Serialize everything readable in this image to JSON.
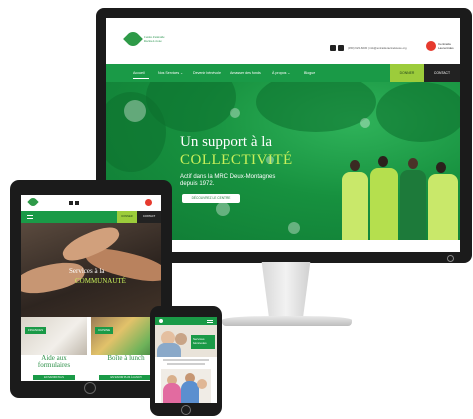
{
  "desktop": {
    "logo": {
      "name": "Centre d'entraide\nRacine-Lavoie"
    },
    "contact_info": "(450) 623-6030 | info@entraideracinelavoie.org",
    "partner": {
      "name": "Centraide\nLaurentides"
    },
    "nav": [
      {
        "label": "Accueil"
      },
      {
        "label": "Nos Services ⌄"
      },
      {
        "label": "Devenir bénévole"
      },
      {
        "label": "Amasser des fonds"
      },
      {
        "label": "À propos ⌄"
      },
      {
        "label": "Blogue"
      }
    ],
    "donate_label": "DONNER",
    "contact_label": "CONTACT",
    "hero": {
      "headline": "Un support à la",
      "headline_accent": "COLLECTIVITÉ",
      "subtitle": "Actif dans la MRC Deux-Montagnes\ndepuis 1972.",
      "cta": "DÉCOUVREZ LE CENTRE"
    }
  },
  "tablet": {
    "donate_label": "DONNER",
    "contact_label": "CONTACT",
    "hero_line1": "Services à la",
    "hero_line2": "COMMUNAUTÉ",
    "cards": [
      {
        "tag": "FINANCES",
        "title": "Aide aux\nformulaires",
        "button": "EN SAVOIR PLUS"
      },
      {
        "tag": "CUISINE",
        "title": "Boîte à lunch",
        "button": "EN SAVOIR PLUS À LUNCH"
      }
    ]
  },
  "phone": {
    "hero_tag": "Services bénévoles"
  },
  "colors": {
    "brand_green": "#1a9a47",
    "accent_lime": "#c8f05a",
    "donate_green": "#9ccc3b",
    "device_frame": "#1b1b1b"
  }
}
